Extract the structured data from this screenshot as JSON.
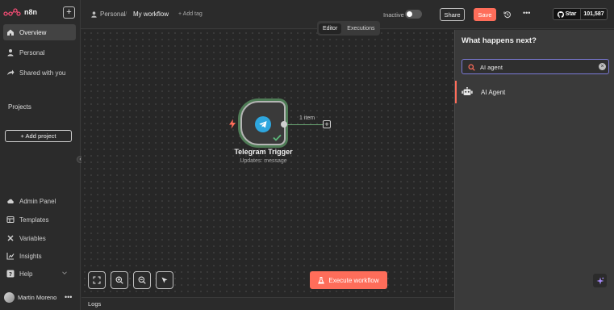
{
  "app": {
    "name": "n8n",
    "accent": "#ff6d5a"
  },
  "sidebar": {
    "create_button": "+",
    "top_items": [
      {
        "label": "Overview",
        "icon": "home-icon",
        "active": true
      },
      {
        "label": "Personal",
        "icon": "user-icon"
      },
      {
        "label": "Shared with you",
        "icon": "share-icon"
      }
    ],
    "projects_label": "Projects",
    "add_project_label": "+ Add project",
    "bottom_items": [
      {
        "label": "Admin Panel",
        "icon": "cloud-icon"
      },
      {
        "label": "Templates",
        "icon": "templates-icon"
      },
      {
        "label": "Variables",
        "icon": "variables-icon"
      },
      {
        "label": "Insights",
        "icon": "insights-icon"
      },
      {
        "label": "Help",
        "icon": "help-icon"
      }
    ],
    "user": {
      "name": "Martin Moreno",
      "more": "•••"
    },
    "collapse_glyph": "‹"
  },
  "header": {
    "breadcrumb_project": "Personal",
    "breadcrumb_sep": "/",
    "workflow_title": "My workflow",
    "add_tag": "+ Add tag",
    "status_label": "Inactive",
    "share_label": "Share",
    "save_label": "Save",
    "more_label": "•••",
    "github": {
      "star_label": "Star",
      "count": "101,587"
    }
  },
  "view_tabs": [
    {
      "label": "Editor",
      "active": true
    },
    {
      "label": "Executions",
      "active": false
    }
  ],
  "canvas": {
    "node": {
      "title": "Telegram Trigger",
      "subtitle": "Updates: message",
      "icon": "telegram-icon",
      "status": "success"
    },
    "edge_label": "1 item",
    "add_node_glyph": "+",
    "execute_label": "Execute workflow",
    "controls": [
      "fit-view-icon",
      "zoom-in-icon",
      "zoom-out-icon",
      "tidy-up-icon"
    ]
  },
  "logs": {
    "label": "Logs"
  },
  "panel": {
    "title": "What happens next?",
    "search_value": "AI agent",
    "clear_glyph": "×",
    "results": [
      {
        "label": "AI Agent",
        "icon": "robot-icon"
      }
    ]
  }
}
